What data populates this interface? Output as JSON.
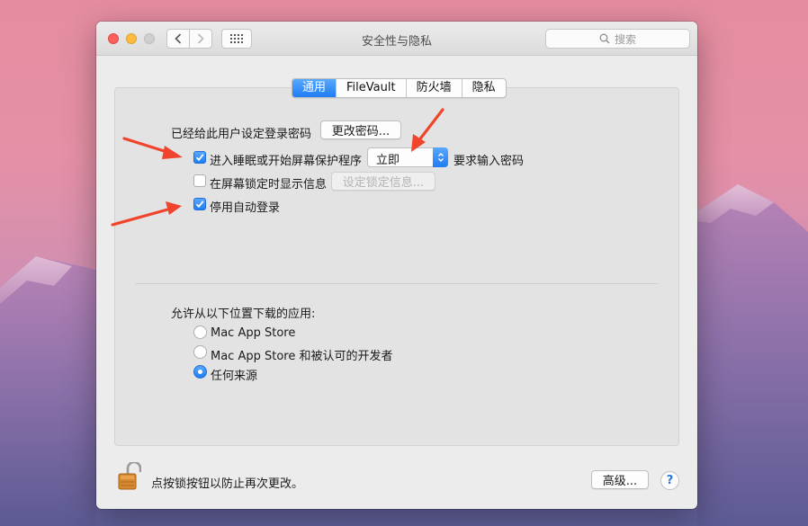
{
  "window": {
    "title": "安全性与隐私",
    "search_placeholder": "搜索"
  },
  "tabs": [
    {
      "label": "通用",
      "active": true
    },
    {
      "label": "FileVault",
      "active": false
    },
    {
      "label": "防火墙",
      "active": false
    },
    {
      "label": "隐私",
      "active": false
    }
  ],
  "general": {
    "password_label": "已经给此用户设定登录密码",
    "change_password_button": "更改密码...",
    "require_password": {
      "checked": true,
      "label": "进入睡眠或开始屏幕保护程序",
      "selected_option": "立即",
      "suffix": "要求输入密码"
    },
    "show_message": {
      "checked": false,
      "label": "在屏幕锁定时显示信息",
      "button": "设定锁定信息..."
    },
    "disable_autologin": {
      "checked": true,
      "label": "停用自动登录"
    }
  },
  "downloads": {
    "heading": "允许从以下位置下载的应用:",
    "options": [
      {
        "label": "Mac App Store",
        "selected": false
      },
      {
        "label": "Mac App Store 和被认可的开发者",
        "selected": false
      },
      {
        "label": "任何来源",
        "selected": true
      }
    ]
  },
  "footer": {
    "lock_text": "点按锁按钮以防止再次更改。",
    "advanced_button": "高级...",
    "help_symbol": "?"
  },
  "colors": {
    "accent": "#1e7cf4",
    "annotation_arrow": "#f0442c",
    "close": "#fc605c",
    "minimize": "#fdbc40"
  }
}
